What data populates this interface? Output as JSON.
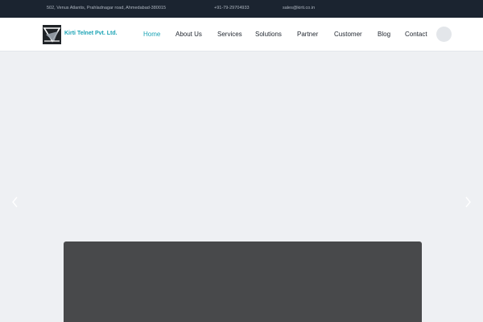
{
  "topbar": {
    "address": "502, Venus Atlantis, Prahladnagar road, Ahmedabad-380015",
    "phone": "+91-79-29704933",
    "email": "sales@kirti.co.in"
  },
  "header": {
    "brand": "Kirti Telnet Pvt. Ltd.",
    "logo_icon": "kirti-telnet-logo",
    "accent_color": "#1aa3b5",
    "nav": [
      {
        "label": "Home",
        "active": true
      },
      {
        "label": "About Us"
      },
      {
        "label": "Services"
      },
      {
        "label": "Solutions"
      },
      {
        "label": "Partner"
      },
      {
        "label": "Customer"
      },
      {
        "label": "Blog"
      },
      {
        "label": "Contact"
      }
    ],
    "search_icon": "search-icon"
  },
  "hero": {
    "prev_icon": "chevron-left-icon",
    "next_icon": "chevron-right-icon",
    "panel_color": "#48494b"
  }
}
